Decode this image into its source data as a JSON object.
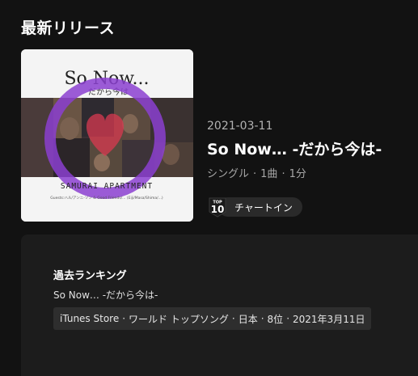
{
  "section_title": "最新リリース",
  "release": {
    "cover": {
      "title_text": "So Now...",
      "subtitle_text": "だから今は",
      "artist_text": "SAMURAI APARTMENT",
      "credits_text": "Guests:ハル/アンニ-ソン & Good Friends/... (Eiji/Masa/Shima/...)"
    },
    "date": "2021-03-11",
    "title": "So Now… -だから今は-",
    "meta": {
      "type": "シングル",
      "tracks": "1曲",
      "duration": "1分",
      "separator": "·"
    },
    "chart_badge": {
      "top_text": "TOP",
      "number_text": "10",
      "label": "チャートイン"
    }
  },
  "history": {
    "heading": "過去ランキング",
    "song": "So Now… -だから今は-",
    "entry": {
      "store": "iTunes Store",
      "chart": "ワールド トップソング",
      "country": "日本",
      "rank": "8位",
      "date": "2021年3月11日",
      "separator": "·"
    }
  },
  "colors": {
    "background": "#121212",
    "panel": "#1c1c1c",
    "pill": "#2a2a2a",
    "muted_text": "#b3b3b3",
    "cover_purple": "#8b3fd0"
  }
}
